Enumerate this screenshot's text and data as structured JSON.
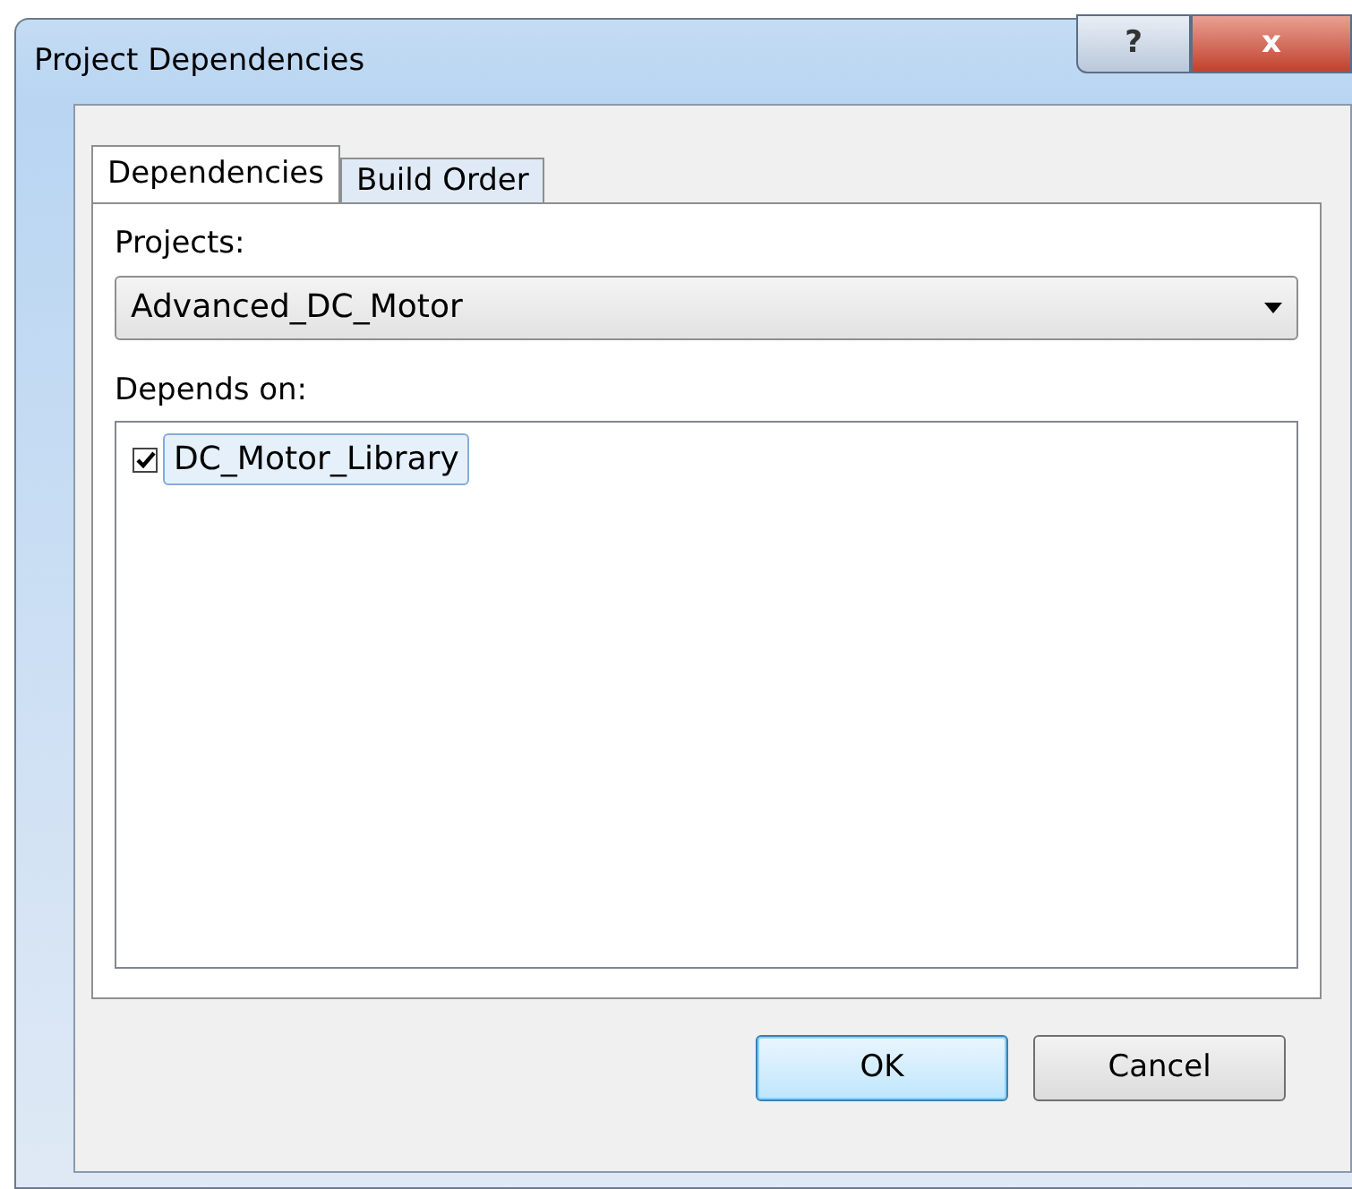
{
  "window": {
    "title": "Project Dependencies",
    "help_button": "?",
    "close_button": "x"
  },
  "tabs": [
    {
      "label": "Dependencies",
      "selected": true
    },
    {
      "label": "Build Order",
      "selected": false
    }
  ],
  "projects": {
    "label": "Projects:",
    "value": "Advanced_DC_Motor"
  },
  "depends_on": {
    "label": "Depends on:",
    "items": [
      {
        "label": "DC_Motor_Library",
        "checked": true,
        "selected": true
      }
    ]
  },
  "buttons": [
    {
      "label": "OK",
      "default": true
    },
    {
      "label": "Cancel",
      "default": false
    }
  ]
}
